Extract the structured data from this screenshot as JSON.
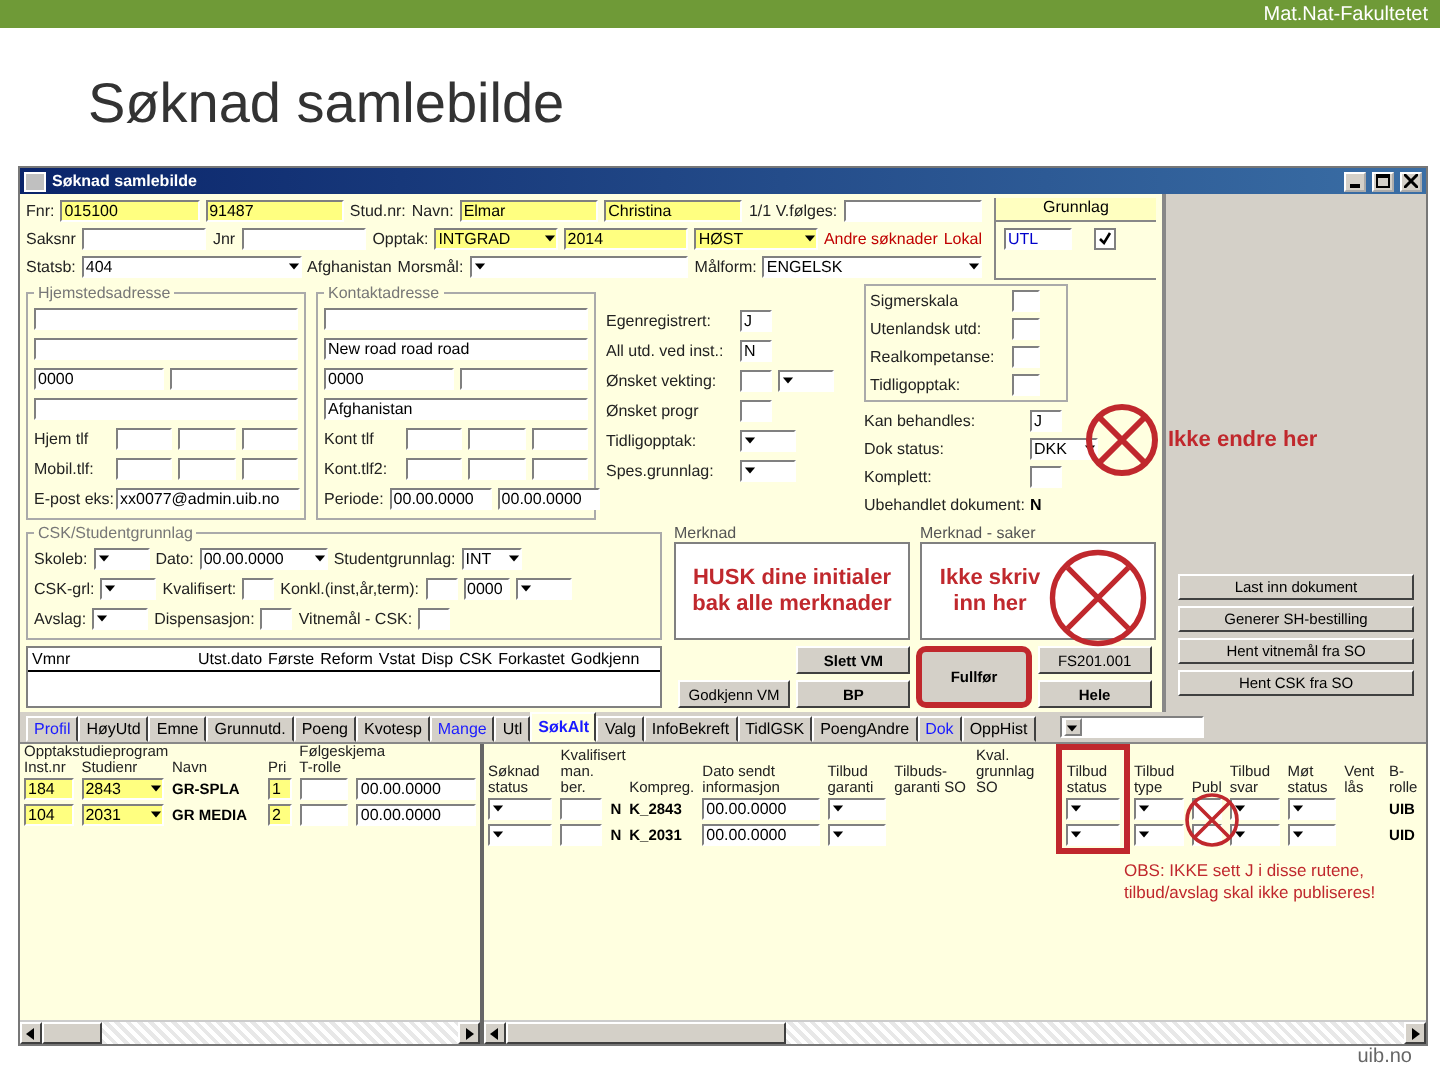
{
  "slide": {
    "header": "Mat.Nat-Fakultetet",
    "title": "Søknad samlebilde",
    "footer": "uib.no"
  },
  "window": {
    "title": "Søknad samlebilde"
  },
  "top_rows": [
    [
      {
        "kind": "label",
        "text": "Fnr:"
      },
      {
        "kind": "field",
        "value": "015100",
        "required": true
      },
      {
        "kind": "field",
        "value": "91487",
        "required": true
      },
      {
        "kind": "label",
        "text": "Stud.nr:"
      },
      {
        "kind": "label",
        "text": "Navn:"
      },
      {
        "kind": "field",
        "value": "Elmar",
        "required": true
      },
      {
        "kind": "field",
        "value": "Christina",
        "required": true
      },
      {
        "kind": "label",
        "text": "1/1 V.følges:"
      },
      {
        "kind": "field",
        "required": false
      }
    ],
    [
      {
        "kind": "label",
        "text": "Saksnr"
      },
      {
        "kind": "field",
        "required": false
      },
      {
        "kind": "label",
        "text": "Jnr"
      },
      {
        "kind": "field",
        "required": false
      },
      {
        "kind": "label",
        "text": "Opptak:"
      },
      {
        "kind": "select",
        "value": "INTGRAD",
        "required": true
      },
      {
        "kind": "field",
        "value": "2014",
        "required": true
      },
      {
        "kind": "select",
        "value": "HØST",
        "required": true
      },
      {
        "kind": "note",
        "text": "Andre søknader"
      },
      {
        "kind": "note",
        "text": "Lokal"
      }
    ],
    [
      {
        "kind": "label",
        "text": "Statsb:"
      },
      {
        "kind": "select",
        "value": "404",
        "required": false
      },
      {
        "kind": "label",
        "text": "Afghanistan"
      },
      {
        "kind": "label",
        "text": "Morsmål:"
      },
      {
        "kind": "select",
        "required": false
      },
      {
        "kind": "label",
        "text": "Målform:"
      },
      {
        "kind": "select",
        "value": "ENGELSK",
        "required": false
      }
    ]
  ],
  "grunnlag": {
    "title": "Grunnlag",
    "value": "UTL",
    "checked": true
  },
  "hjemsted": {
    "legend": "Hjemstedsadresse",
    "rows": [
      [
        {
          "kind": "field",
          "required": false
        }
      ],
      [
        {
          "kind": "field",
          "required": false
        }
      ],
      [
        {
          "kind": "field",
          "value": "0000",
          "required": false
        },
        {
          "kind": "field",
          "required": false
        }
      ],
      [
        {
          "kind": "field",
          "required": false
        }
      ],
      [
        {
          "kind": "label",
          "text": "Hjem tlf"
        },
        {
          "kind": "field",
          "required": false
        },
        {
          "kind": "field",
          "required": false
        },
        {
          "kind": "field",
          "required": false
        }
      ],
      [
        {
          "kind": "label",
          "text": "Mobil.tlf:"
        },
        {
          "kind": "field",
          "required": false
        },
        {
          "kind": "field",
          "required": false
        },
        {
          "kind": "field",
          "required": false
        }
      ],
      [
        {
          "kind": "label",
          "text": "E-post eks:"
        },
        {
          "kind": "field",
          "value": "xx0077@admin.uib.no",
          "required": false
        }
      ]
    ]
  },
  "kontakt": {
    "legend": "Kontaktadresse",
    "rows": [
      [
        {
          "kind": "field",
          "required": false
        }
      ],
      [
        {
          "kind": "field",
          "value": "New road road road",
          "required": false
        }
      ],
      [
        {
          "kind": "field",
          "value": "0000",
          "required": false
        },
        {
          "kind": "field",
          "required": false
        }
      ],
      [
        {
          "kind": "field",
          "value": "Afghanistan",
          "required": false
        }
      ],
      [
        {
          "kind": "label",
          "text": "Kont tlf"
        },
        {
          "kind": "field",
          "required": false
        },
        {
          "kind": "field",
          "required": false
        },
        {
          "kind": "field",
          "required": false
        }
      ],
      [
        {
          "kind": "label",
          "text": "Kont.tlf2:"
        },
        {
          "kind": "field",
          "required": false
        },
        {
          "kind": "field",
          "required": false
        },
        {
          "kind": "field",
          "required": false
        }
      ],
      [
        {
          "kind": "label",
          "text": "Periode:"
        },
        {
          "kind": "field",
          "value": "00.00.0000",
          "required": false
        },
        {
          "kind": "field",
          "value": "00.00.0000",
          "required": false
        }
      ]
    ]
  },
  "personal_rows": [
    [
      {
        "kind": "label",
        "text": "Egenregistrert:"
      },
      {
        "kind": "field",
        "value": "J",
        "required": false
      }
    ],
    [
      {
        "kind": "label",
        "text": "All utd. ved inst.:"
      },
      {
        "kind": "field",
        "value": "N",
        "required": false
      }
    ],
    [
      {
        "kind": "label",
        "text": "Ønsket vekting:"
      },
      {
        "kind": "field",
        "required": false
      },
      {
        "kind": "select",
        "required": false
      }
    ],
    [
      {
        "kind": "label",
        "text": "Ønsket progr"
      },
      {
        "kind": "field",
        "required": false
      }
    ],
    [
      {
        "kind": "label",
        "text": "Tidligopptak:"
      },
      {
        "kind": "select",
        "required": false
      }
    ],
    [
      {
        "kind": "label",
        "text": "Spes.grunnlag:"
      },
      {
        "kind": "select",
        "required": false
      }
    ]
  ],
  "check_rows": [
    [
      {
        "kind": "label",
        "text": "Sigmerskala"
      },
      {
        "kind": "field",
        "required": false
      }
    ],
    [
      {
        "kind": "label",
        "text": "Utenlandsk utd:"
      },
      {
        "kind": "field",
        "required": false
      }
    ],
    [
      {
        "kind": "label",
        "text": "Realkompetanse:"
      },
      {
        "kind": "field",
        "required": false
      }
    ],
    [
      {
        "kind": "label",
        "text": "Tidligopptak:"
      },
      {
        "kind": "field",
        "required": false
      }
    ]
  ],
  "status_rows": [
    [
      {
        "kind": "label",
        "text": "Kan behandles:"
      },
      {
        "kind": "field",
        "value": "J",
        "required": false
      }
    ],
    [
      {
        "kind": "label",
        "text": "Dok status:"
      },
      {
        "kind": "select",
        "value": "DKK",
        "required": false
      }
    ],
    [
      {
        "kind": "label",
        "text": "Komplett:"
      },
      {
        "kind": "field",
        "required": false
      }
    ],
    [
      {
        "kind": "label",
        "text": "Ubehandlet dokument:"
      },
      {
        "kind": "text",
        "text": "N"
      }
    ]
  ],
  "csk": {
    "legend": "CSK/Studentgrunnlag",
    "rows": [
      [
        {
          "kind": "label",
          "text": "Skoleb:"
        },
        {
          "kind": "select",
          "required": false
        },
        {
          "kind": "label",
          "text": "Dato:"
        },
        {
          "kind": "select",
          "value": "00.00.0000",
          "required": false
        },
        {
          "kind": "label",
          "text": "Studentgrunnlag:"
        },
        {
          "kind": "select",
          "value": "INT",
          "required": false
        }
      ],
      [
        {
          "kind": "label",
          "text": "CSK-grl:"
        },
        {
          "kind": "select",
          "required": false
        },
        {
          "kind": "label",
          "text": "Kvalifisert:"
        },
        {
          "kind": "field",
          "required": false
        },
        {
          "kind": "label",
          "text": "Konkl.(inst,år,term):"
        },
        {
          "kind": "field",
          "required": false
        },
        {
          "kind": "field",
          "value": "0000",
          "required": false
        },
        {
          "kind": "select",
          "required": false
        }
      ],
      [
        {
          "kind": "label",
          "text": "Avslag:"
        },
        {
          "kind": "select",
          "required": false
        },
        {
          "kind": "label",
          "text": "Dispensasjon:"
        },
        {
          "kind": "field",
          "required": false
        },
        {
          "kind": "label",
          "text": "Vitnemål - CSK:"
        },
        {
          "kind": "field",
          "required": false
        }
      ]
    ]
  },
  "vm_table": {
    "columns": [
      "Vmnr",
      "Utst.dato",
      "Første",
      "Reform",
      "Vstat",
      "Disp",
      "CSK",
      "Forkastet",
      "Godkjenn"
    ]
  },
  "merknad": {
    "label": "Merknad",
    "text": "HUSK dine initialer bak alle merknader"
  },
  "merknad_saker": {
    "label": "Merknad - saker",
    "text": "Ikke skriv inn her"
  },
  "action_buttons": [
    {
      "label": "Slett VM",
      "highlighted": false
    },
    {
      "label": "Fullfør",
      "highlighted": true
    },
    {
      "label": "FS201.001",
      "highlighted": false
    },
    {
      "label": "Godkjenn VM",
      "highlighted": false
    },
    {
      "label": "BP",
      "highlighted": false
    },
    {
      "label": "Hele",
      "highlighted": false
    }
  ],
  "side_buttons": [
    "Last inn dokument",
    "Generer SH-bestilling",
    "Hent vitnemål fra SO",
    "Hent CSK fra SO"
  ],
  "annotation": "Ikke endre her",
  "tabs": [
    {
      "label": "Profil",
      "selected": false,
      "highlighted": true
    },
    {
      "label": "HøyUtd",
      "selected": false,
      "highlighted": false
    },
    {
      "label": "Emne",
      "selected": false,
      "highlighted": false
    },
    {
      "label": "Grunnutd.",
      "selected": false,
      "highlighted": false
    },
    {
      "label": "Poeng",
      "selected": false,
      "highlighted": false
    },
    {
      "label": "Kvotesp",
      "selected": false,
      "highlighted": false
    },
    {
      "label": "Mange",
      "selected": false,
      "highlighted": true
    },
    {
      "label": "Utl",
      "selected": false,
      "highlighted": false
    },
    {
      "label": "SøkAlt",
      "selected": true,
      "highlighted": true
    },
    {
      "label": "Valg",
      "selected": false,
      "highlighted": false
    },
    {
      "label": "InfoBekreft",
      "selected": false,
      "highlighted": false
    },
    {
      "label": "TidlGSK",
      "selected": false,
      "highlighted": false
    },
    {
      "label": "PoengAndre",
      "selected": false,
      "highlighted": false
    },
    {
      "label": "Dok",
      "selected": false,
      "highlighted": true
    },
    {
      "label": "OppHist",
      "selected": false,
      "highlighted": false
    }
  ],
  "program_grid": {
    "title": "Opptakstudieprogram",
    "group": "Følgeskjema",
    "columns": [
      "Inst.nr",
      "Studienr",
      "Navn",
      "Pri",
      "T-rolle"
    ],
    "rows": [
      [
        {
          "kind": "field",
          "value": "184",
          "required": true
        },
        {
          "kind": "select",
          "value": "2843",
          "required": true
        },
        {
          "kind": "text",
          "text": "GR-SPLA"
        },
        {
          "kind": "field",
          "value": "1",
          "required": true
        },
        {
          "kind": "field",
          "required": false
        },
        {
          "kind": "field",
          "value": "00.00.0000",
          "required": false
        }
      ],
      [
        {
          "kind": "field",
          "value": "104",
          "required": true
        },
        {
          "kind": "select",
          "value": "2031",
          "required": true
        },
        {
          "kind": "text",
          "text": "GR MEDIA"
        },
        {
          "kind": "field",
          "value": "2",
          "required": true
        },
        {
          "kind": "field",
          "required": false
        },
        {
          "kind": "field",
          "value": "00.00.0000",
          "required": false
        }
      ]
    ]
  },
  "offer_grid": {
    "group": "Kvalifisert",
    "columns": [
      {
        "label": "Søknad status",
        "highlighted": false
      },
      {
        "label": "man. ber.",
        "highlighted": false
      },
      {
        "highlighted": false
      },
      {
        "label": "Kompreg.",
        "highlighted": false
      },
      {
        "label": "Dato sendt informasjon",
        "highlighted": false
      },
      {
        "label": "Tilbud garanti",
        "highlighted": false
      },
      {
        "label": "Tilbuds-garanti SO",
        "highlighted": false
      },
      {
        "label": "Kval. grunnlag SO",
        "highlighted": false
      },
      {
        "label": "Tilbud status",
        "highlighted": true
      },
      {
        "label": "Tilbud type",
        "highlighted": false
      },
      {
        "label": "Publ",
        "highlighted": false
      },
      {
        "label": "Tilbud svar",
        "highlighted": false
      },
      {
        "label": "Møt status",
        "highlighted": false
      },
      {
        "label": "Vent lås",
        "highlighted": false
      },
      {
        "label": "B-rolle",
        "highlighted": false
      }
    ],
    "rows": [
      [
        {
          "kind": "select",
          "required": false
        },
        {
          "kind": "field",
          "required": false
        },
        {
          "kind": "text",
          "text": "N"
        },
        {
          "kind": "text",
          "text": "K_2843"
        },
        {
          "kind": "field",
          "value": "00.00.0000",
          "required": false
        },
        {
          "kind": "select",
          "required": false
        },
        {
          "kind": "empty"
        },
        {
          "kind": "empty"
        },
        {
          "kind": "select",
          "required": false
        },
        {
          "kind": "select",
          "required": false
        },
        {
          "kind": "field",
          "required": false
        },
        {
          "kind": "select",
          "required": false
        },
        {
          "kind": "select",
          "required": false
        },
        {
          "kind": "empty"
        },
        {
          "kind": "text",
          "text": "UIB"
        }
      ],
      [
        {
          "kind": "select",
          "required": false
        },
        {
          "kind": "field",
          "required": false
        },
        {
          "kind": "text",
          "text": "N"
        },
        {
          "kind": "text",
          "text": "K_2031"
        },
        {
          "kind": "field",
          "value": "00.00.0000",
          "required": false
        },
        {
          "kind": "select",
          "required": false
        },
        {
          "kind": "empty"
        },
        {
          "kind": "empty"
        },
        {
          "kind": "select",
          "required": false
        },
        {
          "kind": "select",
          "required": false
        },
        {
          "kind": "field",
          "required": false
        },
        {
          "kind": "select",
          "required": false
        },
        {
          "kind": "select",
          "required": false
        },
        {
          "kind": "empty"
        },
        {
          "kind": "text",
          "text": "UID"
        }
      ]
    ],
    "note": "OBS: IKKE sett J i disse rutene, tilbud/avslag skal ikke publiseres!"
  }
}
